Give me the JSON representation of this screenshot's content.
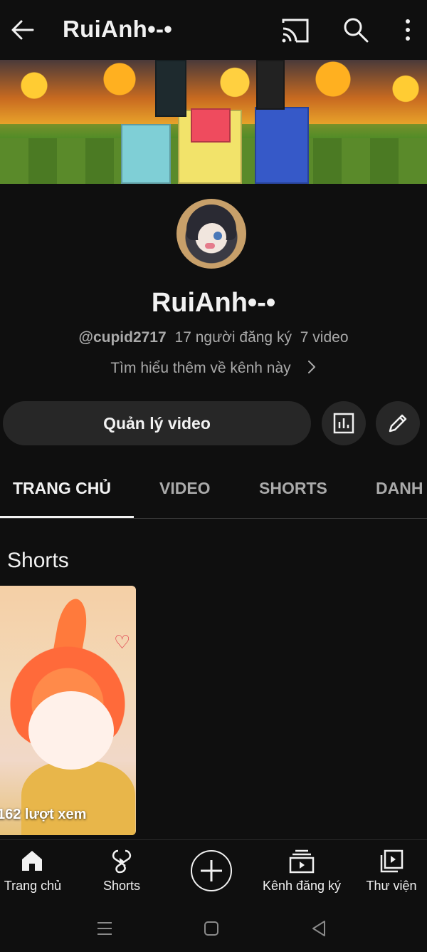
{
  "header": {
    "title": "RuiAnh•-•",
    "back_icon": "arrow-left-icon",
    "cast_icon": "cast-icon",
    "search_icon": "search-icon",
    "more_icon": "more-vertical-icon"
  },
  "channel": {
    "name": "RuiAnh•-•",
    "handle": "@cupid2717",
    "subscribers": "17 người đăng ký",
    "video_count": "7 video",
    "learn_more": "Tìm hiểu thêm về kênh này"
  },
  "actions": {
    "manage_videos": "Quản lý video",
    "analytics_icon": "analytics-icon",
    "edit_icon": "pencil-icon"
  },
  "tabs": [
    {
      "label": "TRANG CHỦ",
      "active": true
    },
    {
      "label": "VIDEO",
      "active": false
    },
    {
      "label": "SHORTS",
      "active": false
    },
    {
      "label": "DANH",
      "active": false
    }
  ],
  "shorts": {
    "section_title": "Shorts",
    "items": [
      {
        "views": "162 lượt xem"
      }
    ]
  },
  "bottom_nav": [
    {
      "label": "Trang chủ",
      "icon": "home-icon"
    },
    {
      "label": "Shorts",
      "icon": "shorts-icon"
    },
    {
      "label": "",
      "icon": "create-plus-icon"
    },
    {
      "label": "Kênh đăng ký",
      "icon": "subscriptions-icon"
    },
    {
      "label": "Thư viện",
      "icon": "library-icon"
    }
  ],
  "system_nav": {
    "recents_icon": "recents-icon",
    "home_icon": "system-home-icon",
    "back_icon": "system-back-icon"
  },
  "colors": {
    "background": "#0f0f0f",
    "surface": "#272727",
    "text_primary": "#f1f1f1",
    "text_secondary": "#aaaaaa"
  }
}
